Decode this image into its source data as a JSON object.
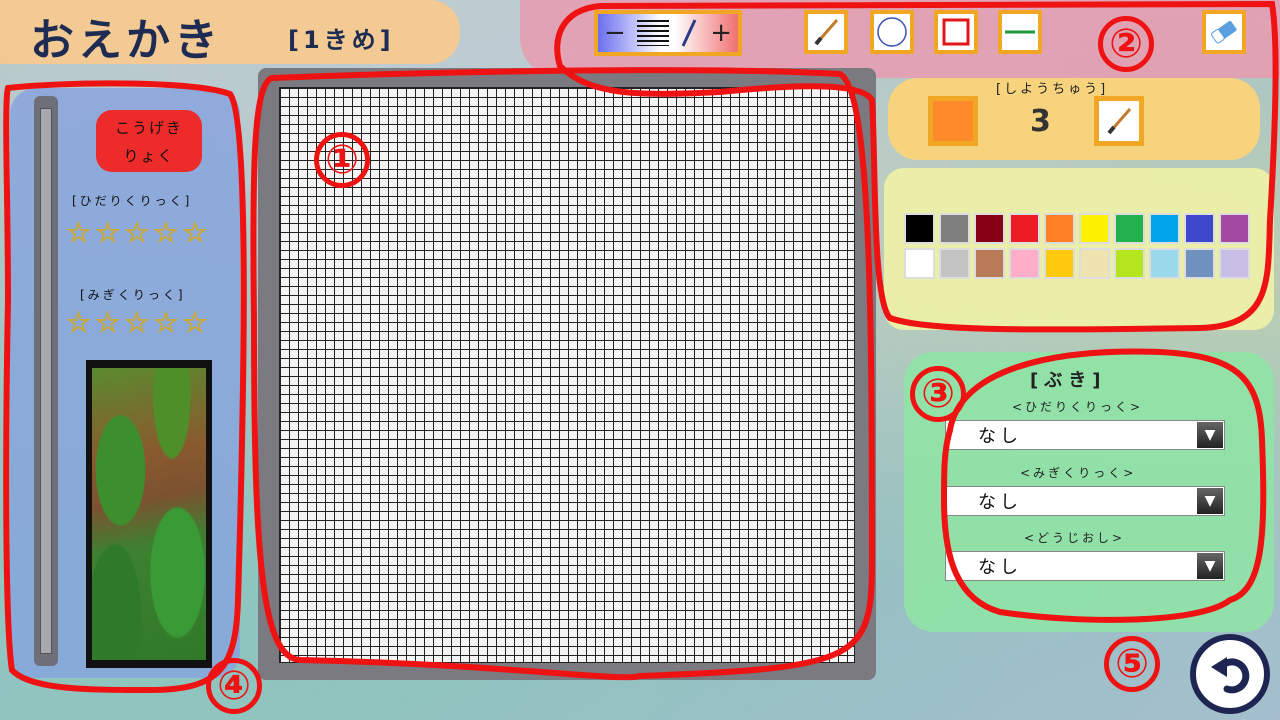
{
  "title": {
    "main": "おえかき",
    "sub": "[1きめ]"
  },
  "toolbar": {
    "size_minus": "−",
    "size_plus": "+",
    "tools": [
      {
        "name": "brush",
        "icon": "brush-icon"
      },
      {
        "name": "circle",
        "icon": "circle-icon"
      },
      {
        "name": "rectangle",
        "icon": "rectangle-icon"
      },
      {
        "name": "line",
        "icon": "line-icon"
      }
    ],
    "eraser_icon": "eraser-icon"
  },
  "in_use": {
    "label": "[しようちゅう]",
    "color": "#ff8a2a",
    "size": "3",
    "tool_icon": "brush-icon"
  },
  "palette": [
    "#000000",
    "#7f7f7f",
    "#880015",
    "#ed1c24",
    "#ff7f27",
    "#fff200",
    "#22b14c",
    "#00a2e8",
    "#3f48cc",
    "#a349a4",
    "#ffffff",
    "#c3c3c3",
    "#b97a57",
    "#ffaec9",
    "#ffc90e",
    "#efe4b0",
    "#b5e61d",
    "#99d9ea",
    "#7092be",
    "#c8bfe7"
  ],
  "weapon": {
    "title": "[ぶき]",
    "left_label": "<ひだりくりっく>",
    "left_value": "なし",
    "right_label": "<みぎくりっく>",
    "right_value": "なし",
    "both_label": "<どうじおし>",
    "both_value": "なし"
  },
  "left_panel": {
    "attack_line1": "こうげき",
    "attack_line2": "りょく",
    "left_click_label": "[ひだりくりっく]",
    "left_stars": "☆☆☆☆☆",
    "right_click_label": "[みぎくりっく]",
    "right_stars": "☆☆☆☆☆"
  },
  "annotations": [
    "①",
    "②",
    "③",
    "④",
    "⑤"
  ]
}
